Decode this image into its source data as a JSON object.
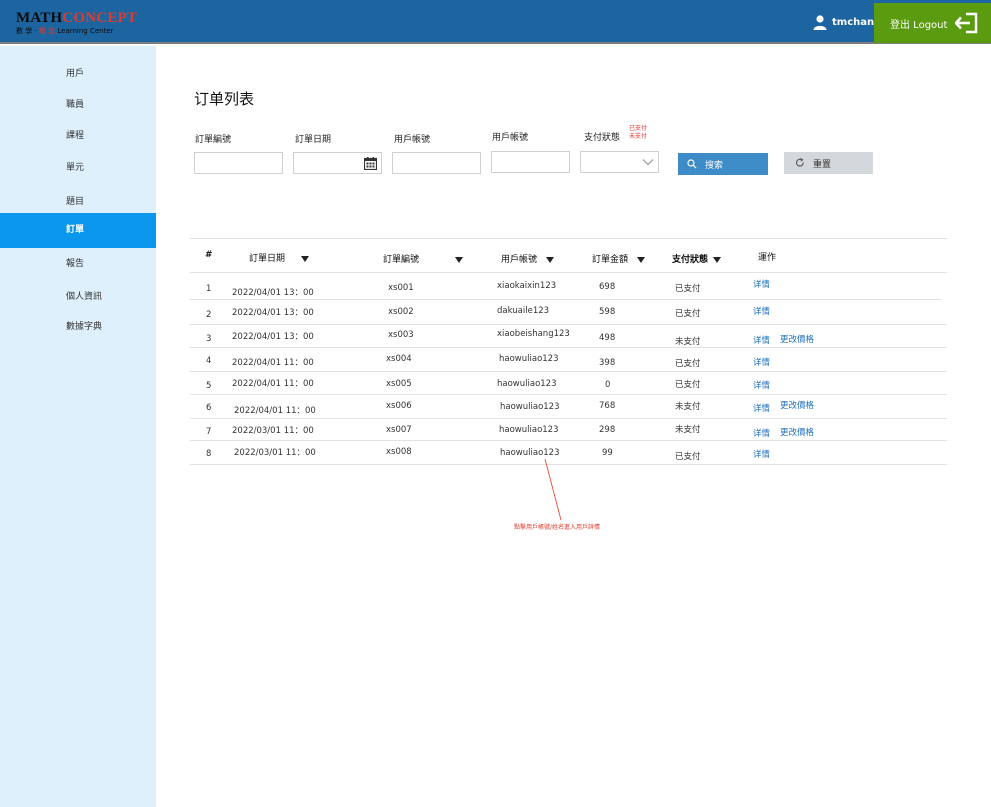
{
  "header": {
    "logo_math": "MATH",
    "logo_concept": "CONCEPT",
    "logo_sub_a": "數 學 · ",
    "logo_sub_red": "概 念",
    "logo_sub_b": " Learning Center",
    "username": "tmchan",
    "logout_label": "登出 Logout",
    "bar_color": "#1d65a1",
    "logout_color": "#5a9b10"
  },
  "sidebar": {
    "items": [
      {
        "label": "用戶"
      },
      {
        "label": "職員"
      },
      {
        "label": "課程"
      },
      {
        "label": "單元"
      },
      {
        "label": "題目"
      },
      {
        "label": "訂單"
      },
      {
        "label": "報告"
      },
      {
        "label": "個人資訊"
      },
      {
        "label": "數據字典"
      }
    ],
    "active_index": 5,
    "active_color": "#0b97ee"
  },
  "main": {
    "title": "订单列表",
    "filters": {
      "order_no_label": "訂單編號",
      "order_date_label": "訂單日期",
      "account1_label": "用戶帳號",
      "account2_label": "用戶帳號",
      "pay_status_label": "支付狀態",
      "pay_status_options": [
        "已支付",
        "未支付"
      ]
    },
    "search_label": "搜索",
    "reset_label": "重置"
  },
  "table": {
    "columns": [
      "#",
      "訂單日期",
      "訂單編號",
      "用戶帳號",
      "訂單金額",
      "支付狀態",
      "運作"
    ],
    "rows": [
      {
        "num": "1",
        "date": "2022/04/01 13：00",
        "order": "xs001",
        "account": "xiaokaixin123",
        "amount": "698",
        "status": "已支付",
        "actions": [
          "详情"
        ]
      },
      {
        "num": "2",
        "date": "2022/04/01 13：00",
        "order": "xs002",
        "account": "dakuaile123",
        "amount": "598",
        "status": "已支付",
        "actions": [
          "详情"
        ]
      },
      {
        "num": "3",
        "date": "2022/04/01 13：00",
        "order": "xs003",
        "account": "xiaobeishang123",
        "amount": "498",
        "status": "未支付",
        "actions": [
          "详情",
          "更改價格"
        ]
      },
      {
        "num": "4",
        "date": "2022/04/01 11：00",
        "order": "xs004",
        "account": "haowuliao123",
        "amount": "398",
        "status": "已支付",
        "actions": [
          "详情"
        ]
      },
      {
        "num": "5",
        "date": "2022/04/01 11：00",
        "order": "xs005",
        "account": "haowuliao123",
        "amount": "0",
        "status": "已支付",
        "actions": [
          "详情"
        ]
      },
      {
        "num": "6",
        "date": "2022/04/01 11：00",
        "order": "xs006",
        "account": "haowuliao123",
        "amount": "768",
        "status": "未支付",
        "actions": [
          "详情",
          "更改價格"
        ]
      },
      {
        "num": "7",
        "date": "2022/03/01 11：00",
        "order": "xs007",
        "account": "haowuliao123",
        "amount": "298",
        "status": "未支付",
        "actions": [
          "详情",
          "更改價格"
        ]
      },
      {
        "num": "8",
        "date": "2022/03/01 11：00",
        "order": "xs008",
        "account": "haowuliao123",
        "amount": "99",
        "status": "已支付",
        "actions": [
          "详情"
        ]
      }
    ],
    "action_color": "#1d6fbf"
  },
  "annotation": {
    "text": "點擊用戶帳號/姓名進入用戶詳情",
    "color": "#e03a2a"
  }
}
